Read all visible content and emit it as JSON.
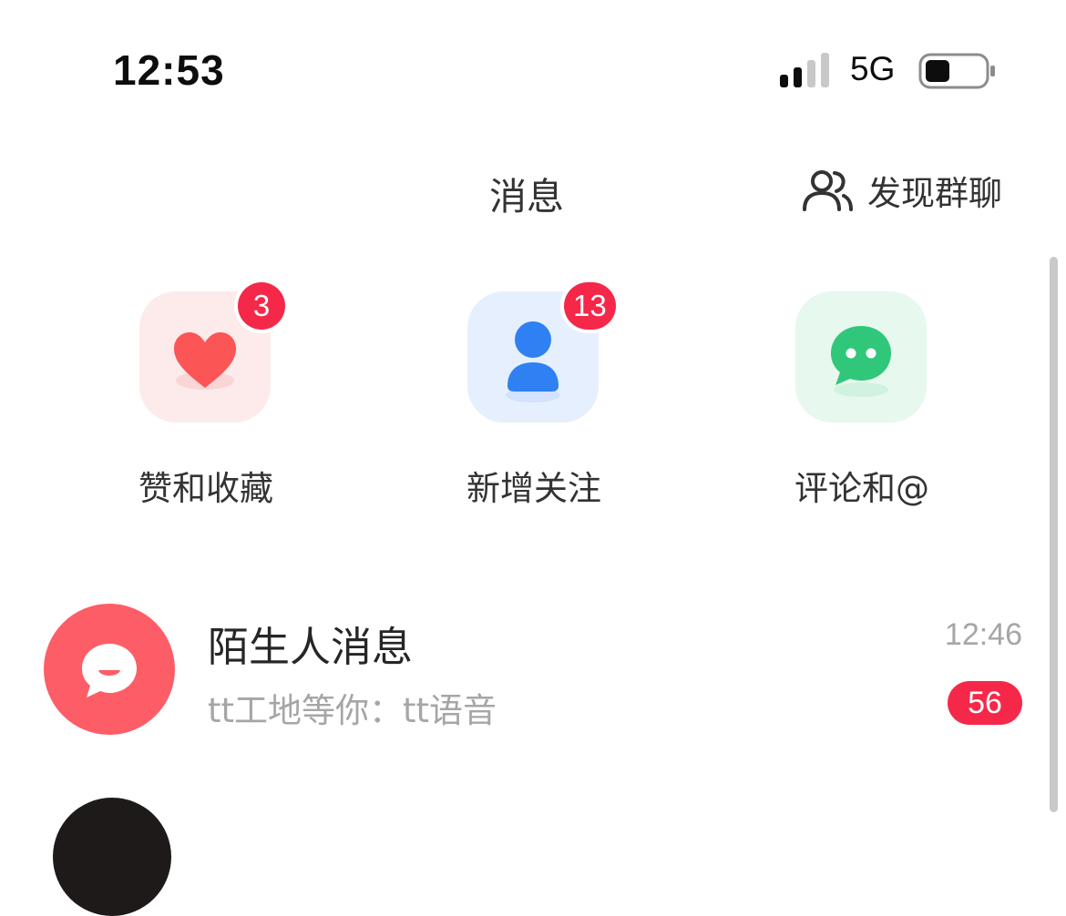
{
  "status_bar": {
    "time": "12:53",
    "network": "5G"
  },
  "header": {
    "title": "消息",
    "discover_label": "发现群聊"
  },
  "shortcuts": [
    {
      "label": "赞和收藏",
      "icon": "heart-icon",
      "badge": "3",
      "tile_color": "#fdebeb",
      "icon_color": "#fb5556"
    },
    {
      "label": "新增关注",
      "icon": "person-icon",
      "badge": "13",
      "tile_color": "#e6effd",
      "icon_color": "#2f80f2"
    },
    {
      "label": "评论和@",
      "icon": "chat-bubble-icon",
      "badge": "",
      "tile_color": "#e7f8ee",
      "icon_color": "#31c77a"
    }
  ],
  "conversations": [
    {
      "name": "陌生人消息",
      "preview": "tt工地等你：tt语音",
      "time": "12:46",
      "unread": "56",
      "avatar_color": "#fd5d66"
    }
  ],
  "colors": {
    "badge": "#f5284a",
    "text_primary": "#262626",
    "text_secondary": "#a6a6a6"
  }
}
